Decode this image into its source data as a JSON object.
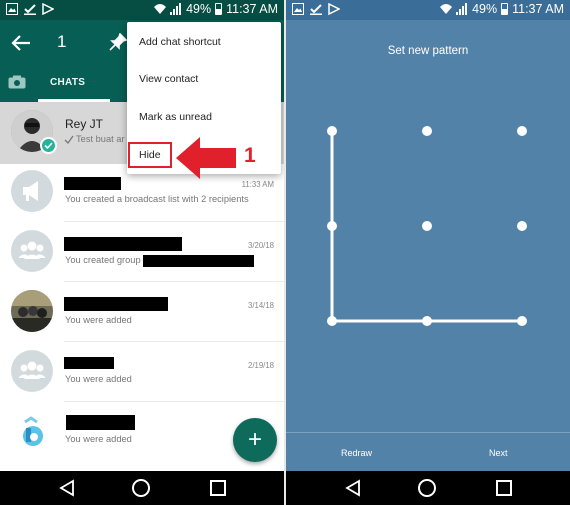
{
  "status_bar": {
    "battery": "49%",
    "time": "11:37 AM"
  },
  "chats_screen": {
    "selection_count": "1",
    "tab_label": "CHATS",
    "menu": {
      "items": [
        "Add chat shortcut",
        "View contact",
        "Mark as unread",
        "Hide"
      ]
    },
    "annotation_number": "1",
    "chats": [
      {
        "name": "Rey JT",
        "message": "Test buat ar",
        "date": ""
      },
      {
        "name": "",
        "message": "You created a broadcast list with 2 recipients",
        "date": "11:33 AM"
      },
      {
        "name": "",
        "message": "You created group",
        "date": "3/20/18"
      },
      {
        "name": "",
        "message": "You were added",
        "date": "3/14/18"
      },
      {
        "name": "",
        "message": "You were added",
        "date": "2/19/18"
      },
      {
        "name": "",
        "message": "You were added",
        "date": ""
      }
    ],
    "fab_symbol": "+"
  },
  "pattern_screen": {
    "title": "Set new pattern",
    "redraw_label": "Redraw",
    "next_label": "Next",
    "pattern_path_nodes": [
      1,
      4,
      7,
      8,
      9
    ]
  },
  "colors": {
    "whatsapp_teal": "#075e54",
    "pattern_background": "#5382a9",
    "annotation_red": "#e0212b"
  },
  "icons": {
    "app_bar": [
      "back-arrow-icon",
      "pin-icon",
      "camera-icon"
    ],
    "nav_bar": [
      "nav-back-icon",
      "nav-home-icon",
      "nav-recents-icon"
    ]
  }
}
